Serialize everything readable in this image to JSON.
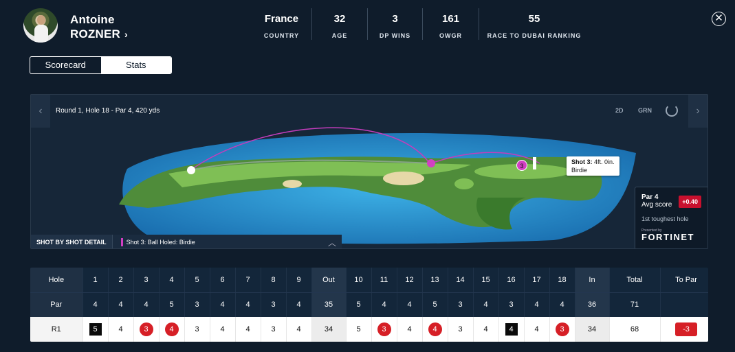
{
  "player": {
    "first_name": "Antoine",
    "last_name": "ROZNER",
    "chevron": "›"
  },
  "stats": [
    {
      "value": "France",
      "label": "COUNTRY"
    },
    {
      "value": "32",
      "label": "AGE"
    },
    {
      "value": "3",
      "label": "DP WINS"
    },
    {
      "value": "161",
      "label": "OWGR"
    },
    {
      "value": "55",
      "label": "RACE TO DUBAI RANKING"
    }
  ],
  "close_glyph": "✕",
  "tabs": [
    {
      "label": "Scorecard",
      "active": true
    },
    {
      "label": "Stats",
      "active": false
    }
  ],
  "map": {
    "hole_info": "Round 1, Hole 18 - Par 4, 420 yds",
    "toggle_2d": "2D",
    "toggle_grn": "GRN",
    "prev_arrow": "‹",
    "next_arrow": "›",
    "callout_title": "Shot 3:",
    "callout_dist": "4ft. 0in.",
    "callout_result": "Birdie",
    "shot_marker_3": "3",
    "shot_detail_header": "SHOT BY SHOT DETAIL",
    "shot_detail_text": "Shot 3: Ball Holed: Birdie",
    "collapse_glyph": "︿",
    "accent_color": "#d23fc2"
  },
  "hole_card": {
    "par_label": "Par 4",
    "avg_label": "Avg score",
    "avg_value": "+0.40",
    "toughness": "1st toughest hole",
    "presented_by": "Presented by",
    "sponsor": "FORTINET"
  },
  "scorecard": {
    "hole_row": [
      "Hole",
      "1",
      "2",
      "3",
      "4",
      "5",
      "6",
      "7",
      "8",
      "9",
      "Out",
      "10",
      "11",
      "12",
      "13",
      "14",
      "15",
      "16",
      "17",
      "18",
      "In",
      "Total",
      "To Par"
    ],
    "par_row": [
      "Par",
      "4",
      "4",
      "4",
      "5",
      "3",
      "4",
      "4",
      "3",
      "4",
      "35",
      "5",
      "4",
      "4",
      "5",
      "3",
      "4",
      "3",
      "4",
      "4",
      "36",
      "71",
      ""
    ],
    "round_row": [
      "R1",
      "5",
      "4",
      "3",
      "4",
      "3",
      "4",
      "4",
      "3",
      "4",
      "34",
      "5",
      "3",
      "4",
      "4",
      "3",
      "4",
      "4",
      "4",
      "3",
      "34",
      "68",
      "-3"
    ],
    "round_marks": [
      "",
      "bogey",
      "",
      "birdie",
      "birdie",
      "",
      "",
      "",
      "",
      "",
      "",
      "",
      "birdie",
      "",
      "birdie",
      "",
      "",
      "bogey",
      "",
      "birdie",
      "",
      "",
      "topar"
    ]
  }
}
